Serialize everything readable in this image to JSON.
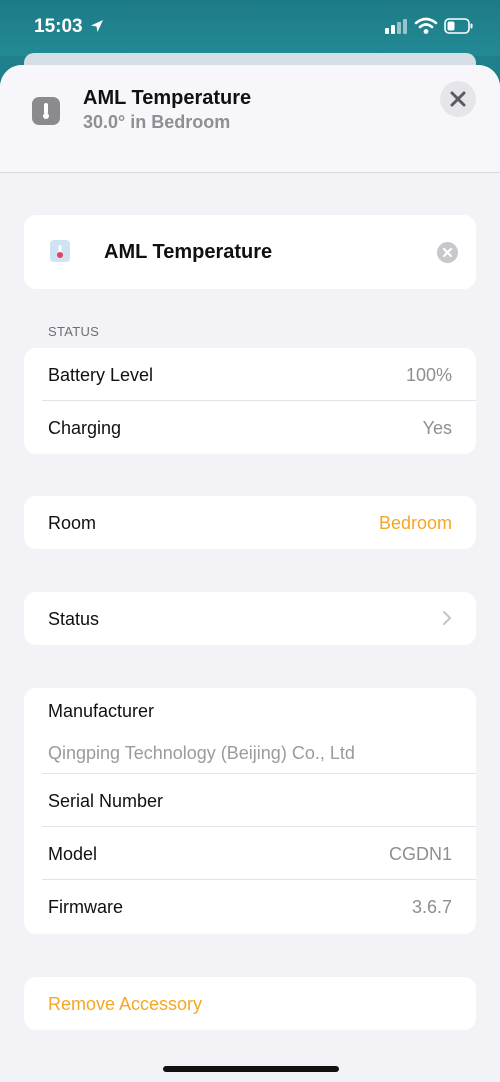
{
  "status_bar": {
    "time": "15:03"
  },
  "header": {
    "title": "AML Temperature",
    "subtitle": "30.0° in Bedroom"
  },
  "name_card": {
    "name": "AML Temperature"
  },
  "status_section": {
    "header": "STATUS",
    "rows": [
      {
        "label": "Battery Level",
        "value": "100%"
      },
      {
        "label": "Charging",
        "value": "Yes"
      }
    ]
  },
  "room": {
    "label": "Room",
    "value": "Bedroom"
  },
  "status_link": {
    "label": "Status"
  },
  "info": {
    "manufacturer_label": "Manufacturer",
    "manufacturer_value": "Qingping Technology (Beijing) Co., Ltd",
    "rows": [
      {
        "label": "Serial Number",
        "value": ""
      },
      {
        "label": "Model",
        "value": "CGDN1"
      },
      {
        "label": "Firmware",
        "value": "3.6.7"
      }
    ]
  },
  "remove": {
    "label": "Remove Accessory"
  },
  "colors": {
    "accent": "#f5a623",
    "sheet_bg": "#f2f2f7",
    "top_bar": "#1f7f8a"
  }
}
